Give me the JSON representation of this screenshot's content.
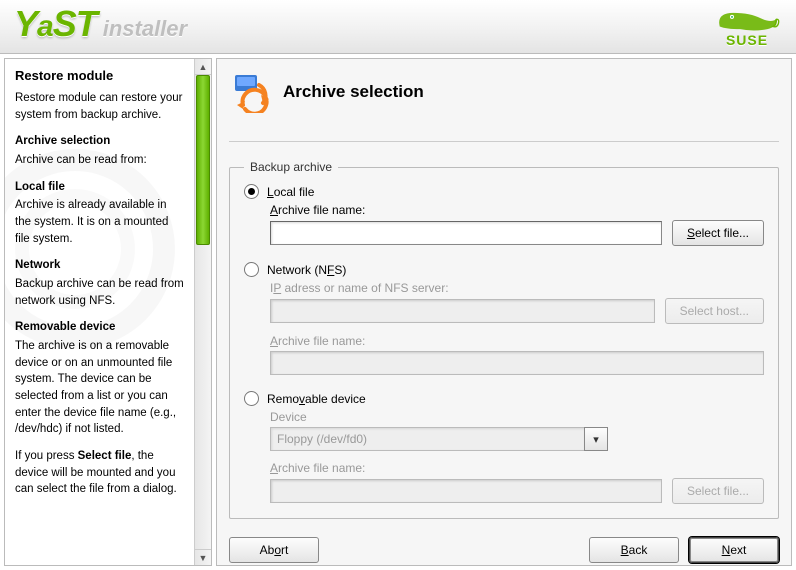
{
  "header": {
    "brand_main": "YaST",
    "brand_sub": "installer",
    "distro": "SUSE"
  },
  "help": {
    "title": "Restore module",
    "intro": "Restore module can restore your system from backup archive.",
    "sections": [
      {
        "h": "Archive selection",
        "p": "Archive can be read from:"
      },
      {
        "h": "Local file",
        "p": "Archive is already available in the system. It is on a mounted file system."
      },
      {
        "h": "Network",
        "p": "Backup archive can be read from network using NFS."
      },
      {
        "h": "Removable device",
        "p": "The archive is on a removable device or on an unmounted file system. The device can be selected from a list or you can enter the device file name (e.g., /dev/hdc) if not listed."
      }
    ],
    "tail_pre": "If you press ",
    "tail_bold": "Select file",
    "tail_post": ", the device will be mounted and you can select the file from a dialog."
  },
  "page": {
    "title": "Archive selection",
    "group_legend": "Backup archive",
    "source": "local",
    "local": {
      "radio": "Local file",
      "file_label": "Archive file name:",
      "file_value": "",
      "select_btn": "Select file..."
    },
    "nfs": {
      "radio": "Network (NFS)",
      "host_label": "IP adress or name of NFS server:",
      "host_value": "",
      "host_btn": "Select host...",
      "file_label": "Archive file name:",
      "file_value": ""
    },
    "removable": {
      "radio": "Removable device",
      "device_label": "Device",
      "device_value": "Floppy (/dev/fd0)",
      "file_label": "Archive file name:",
      "file_value": "",
      "select_btn": "Select file..."
    },
    "buttons": {
      "abort": "Abort",
      "back": "Back",
      "next": "Next"
    }
  }
}
